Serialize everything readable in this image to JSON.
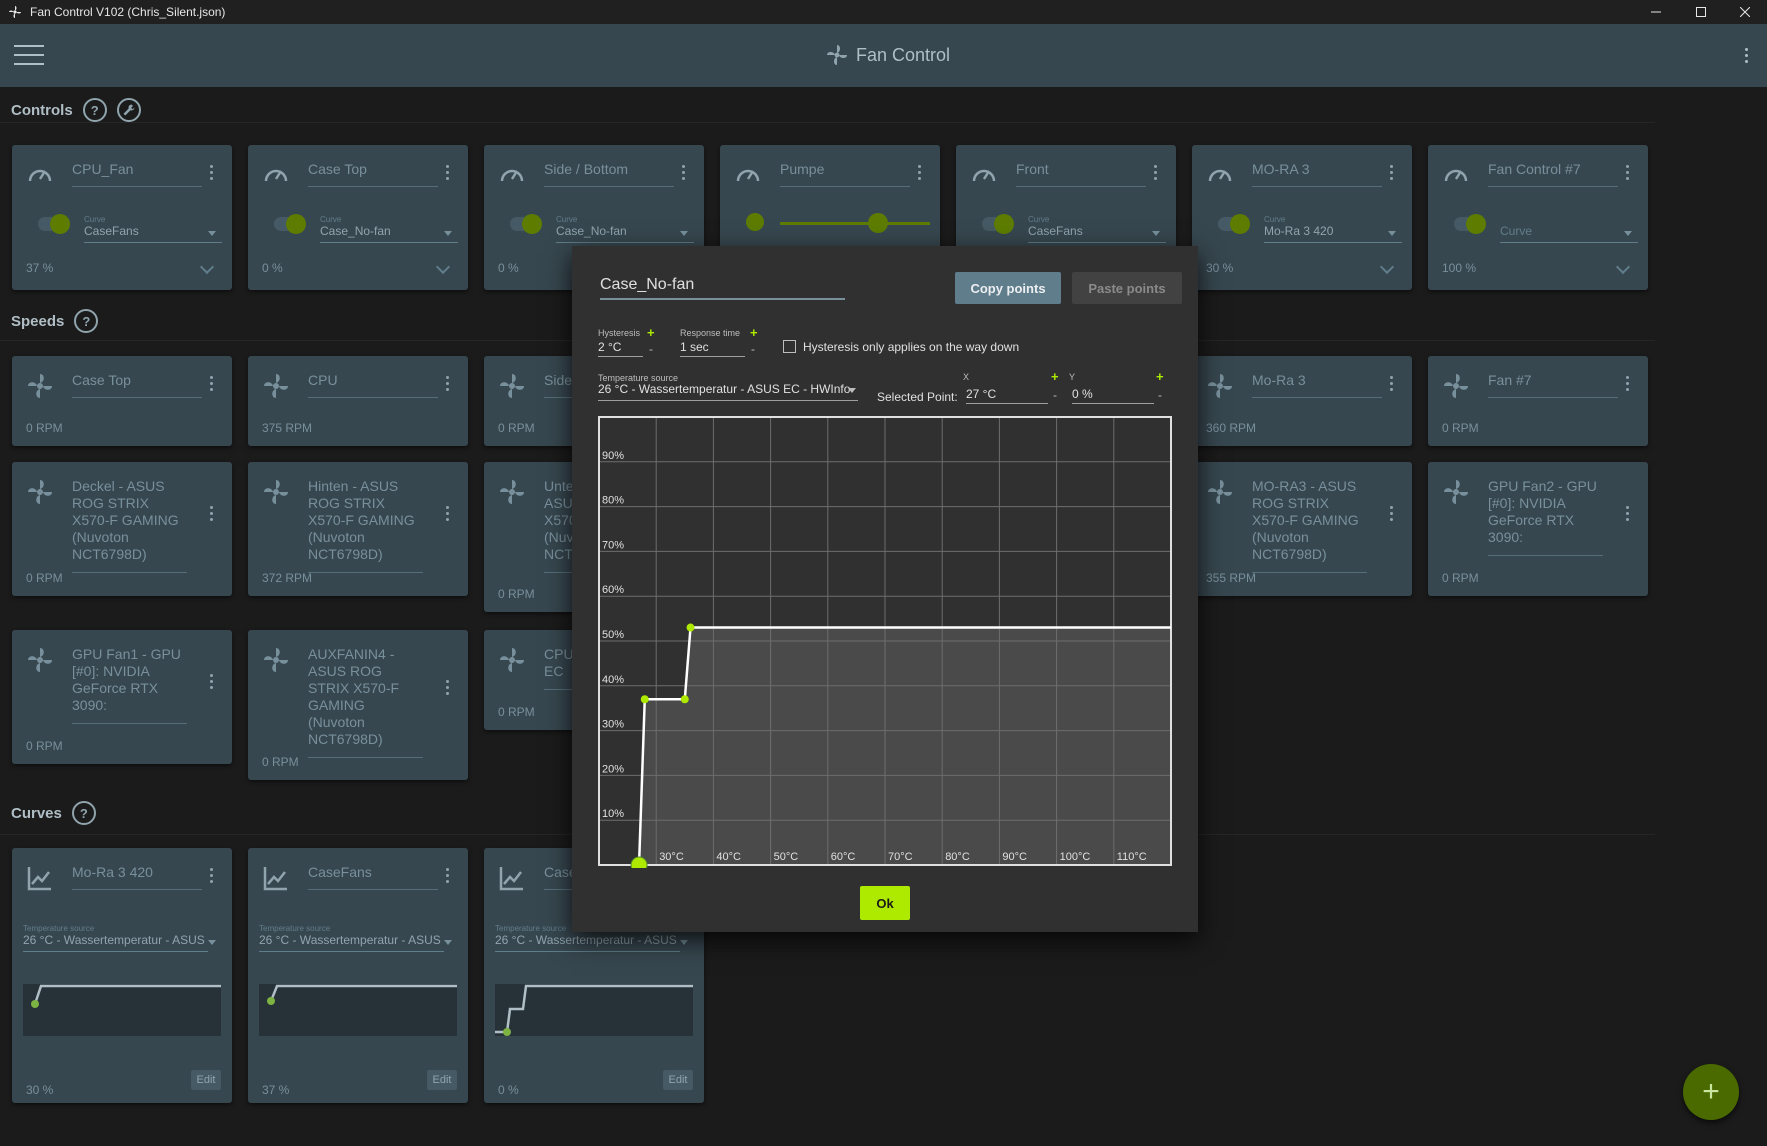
{
  "window": {
    "title": "Fan Control V102 (Chris_Silent.json)"
  },
  "appbar": {
    "title": "Fan Control"
  },
  "sections": {
    "controls": "Controls",
    "speeds": "Speeds",
    "curves": "Curves",
    "help": "?"
  },
  "controls": [
    {
      "name": "CPU_Fan",
      "curve_label": "Curve",
      "curve": "CaseFans",
      "value": "37 %"
    },
    {
      "name": "Case Top",
      "curve_label": "Curve",
      "curve": "Case_No-fan",
      "value": "0 %"
    },
    {
      "name": "Side / Bottom",
      "curve_label": "Curve",
      "curve": "Case_No-fan",
      "value": "0 %"
    },
    {
      "name": "Pumpe",
      "slider_level": 0.65
    },
    {
      "name": "Front",
      "curve_label": "Curve",
      "curve": "CaseFans"
    },
    {
      "name": "MO-RA 3",
      "curve_label": "Curve",
      "curve": "Mo-Ra 3 420",
      "value": "30 %"
    },
    {
      "name": "Fan Control #7",
      "curve_placeholder": "Curve",
      "value": "100 %"
    }
  ],
  "speeds": [
    {
      "name": "Case Top",
      "rpm": "0 RPM"
    },
    {
      "name": "CPU",
      "rpm": "375 RPM"
    },
    {
      "name": "Side",
      "rpm": "0 RPM"
    },
    {
      "name": "Mo-Ra 3",
      "rpm": "360 RPM"
    },
    {
      "name": "Fan #7",
      "rpm": "0 RPM"
    },
    {
      "name": "Deckel - ASUS ROG STRIX X570-F GAMING (Nuvoton NCT6798D)",
      "rpm": "0 RPM"
    },
    {
      "name": "Hinten - ASUS ROG STRIX X570-F GAMING (Nuvoton NCT6798D)",
      "rpm": "372 RPM"
    },
    {
      "name": "Unte ASU X570 (Nuv NCT",
      "rpm": "0 RPM"
    },
    {
      "name": "MO-RA3 - ASUS ROG STRIX X570-F GAMING (Nuvoton NCT6798D)",
      "rpm": "355 RPM"
    },
    {
      "name": "GPU Fan2 - GPU [#0]: NVIDIA GeForce RTX 3090:",
      "rpm": "0 RPM"
    },
    {
      "name": "GPU Fan1 - GPU [#0]: NVIDIA GeForce RTX 3090:",
      "rpm": "0 RPM"
    },
    {
      "name": "AUXFANIN4 - ASUS ROG STRIX X570-F GAMING (Nuvoton NCT6798D)",
      "rpm": "0 RPM"
    },
    {
      "name": "CPU EC",
      "rpm": "0 RPM"
    }
  ],
  "curves": [
    {
      "name": "Mo-Ra 3 420",
      "src_label": "Temperature source",
      "src": "26 °C - Wassertemperatur - ASUS",
      "value": "30 %",
      "edit": "Edit"
    },
    {
      "name": "CaseFans",
      "src_label": "Temperature source",
      "src": "26 °C - Wassertemperatur - ASUS",
      "value": "37 %",
      "edit": "Edit"
    },
    {
      "name": "Case",
      "src_label": "Temperature source",
      "src": "26 °C - Wassertemperatur - ASUS",
      "value": "0 %",
      "edit": "Edit"
    }
  ],
  "fab": {
    "label": "+"
  },
  "dialog": {
    "name": "Case_No-fan",
    "copy": "Copy points",
    "paste": "Paste points",
    "hysteresis_label": "Hysteresis",
    "hysteresis": "2 °C",
    "response_label": "Response time",
    "response": "1 sec",
    "hyst_down": "Hysteresis only applies on the way down",
    "src_label": "Temperature source",
    "src": "26 °C - Wassertemperatur - ASUS EC - HWInfo",
    "selected_label": "Selected Point:",
    "x_label": "X",
    "y_label": "Y",
    "x": "27 °C",
    "y": "0 %",
    "plus": "+",
    "minus": "-",
    "ok": "Ok"
  },
  "chart_data": {
    "type": "line",
    "x_ticks": [
      "30°C",
      "40°C",
      "50°C",
      "60°C",
      "70°C",
      "80°C",
      "90°C",
      "100°C",
      "110°C"
    ],
    "y_ticks": [
      "10%",
      "20%",
      "30%",
      "40%",
      "50%",
      "60%",
      "70%",
      "80%",
      "90%"
    ],
    "xlim": [
      20,
      120
    ],
    "ylim": [
      0,
      100
    ],
    "points": [
      [
        27,
        0
      ],
      [
        28,
        37
      ],
      [
        35,
        37
      ],
      [
        36,
        53
      ],
      [
        120,
        53
      ]
    ],
    "selected_index": 0,
    "colors": {
      "accent": "#aeea00",
      "line": "#ffffff"
    }
  }
}
